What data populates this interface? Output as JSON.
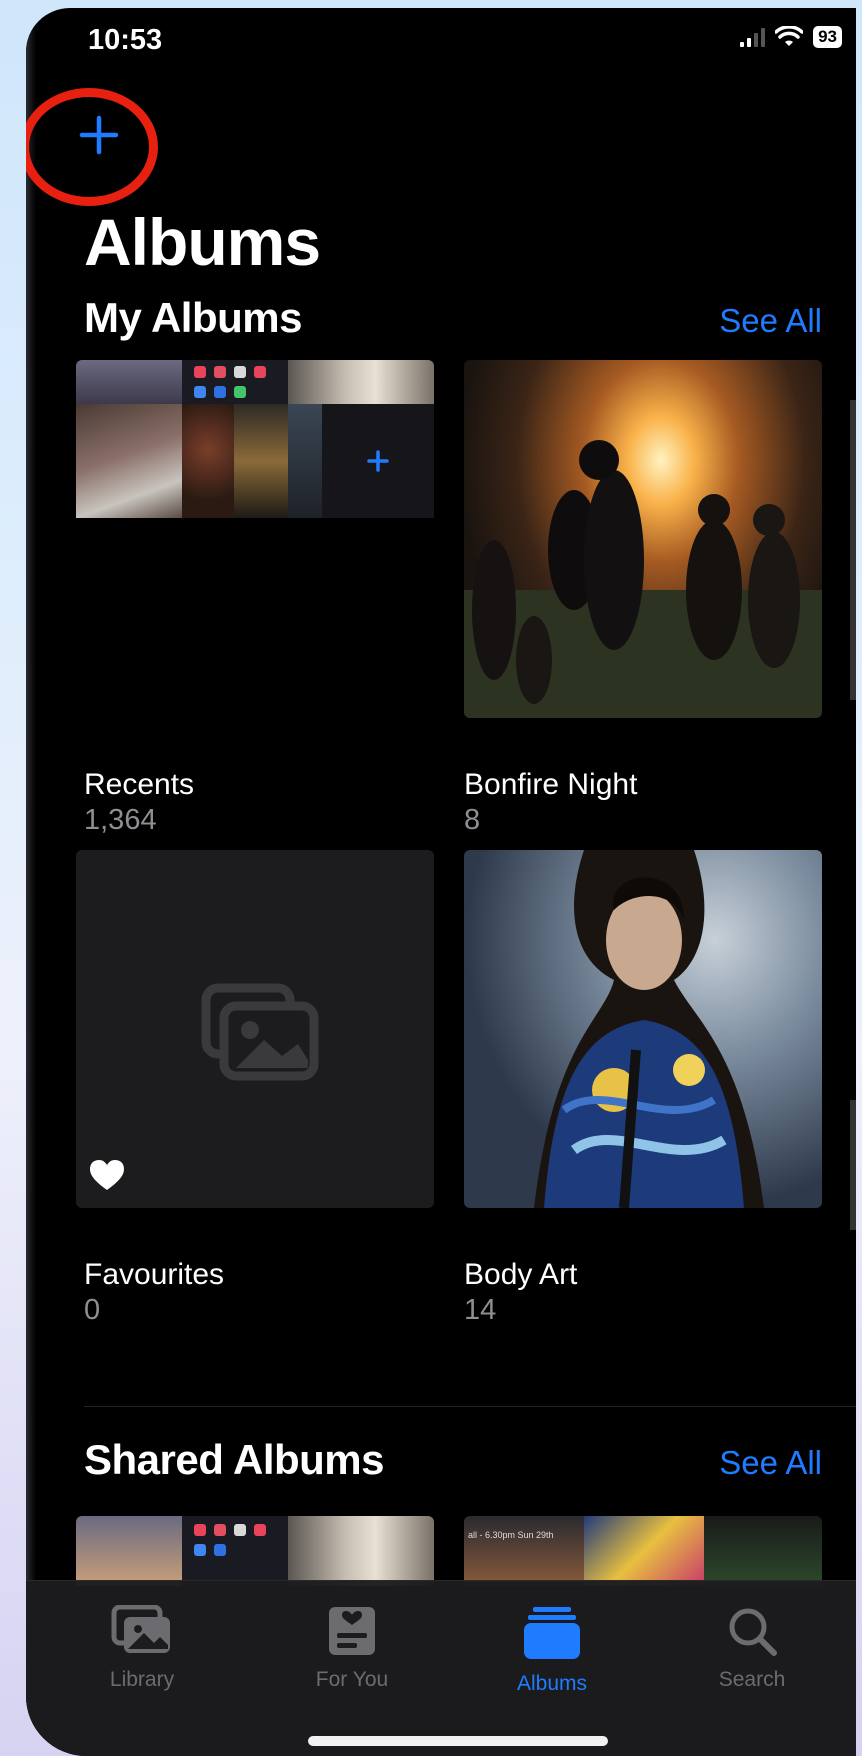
{
  "status_bar": {
    "time": "10:53",
    "battery": "93"
  },
  "header": {
    "title": "Albums"
  },
  "my_albums": {
    "heading": "My Albums",
    "see_all": "See All",
    "albums": [
      {
        "name": "Recents",
        "count": "1,364"
      },
      {
        "name": "Bonfire Night",
        "count": "8"
      },
      {
        "name": "Favourites",
        "count": "0"
      },
      {
        "name": "Body Art",
        "count": "14"
      }
    ]
  },
  "shared_albums": {
    "heading": "Shared Albums",
    "see_all": "See All",
    "banner_text": "all - 6.30pm Sun 29th"
  },
  "tabbar": {
    "tabs": [
      {
        "label": "Library",
        "icon": "photo-library-icon"
      },
      {
        "label": "For You",
        "icon": "for-you-icon"
      },
      {
        "label": "Albums",
        "icon": "albums-icon",
        "active": true
      },
      {
        "label": "Search",
        "icon": "search-icon"
      }
    ]
  },
  "colors": {
    "accent": "#1f7bff",
    "annotation": "#e8200f"
  }
}
